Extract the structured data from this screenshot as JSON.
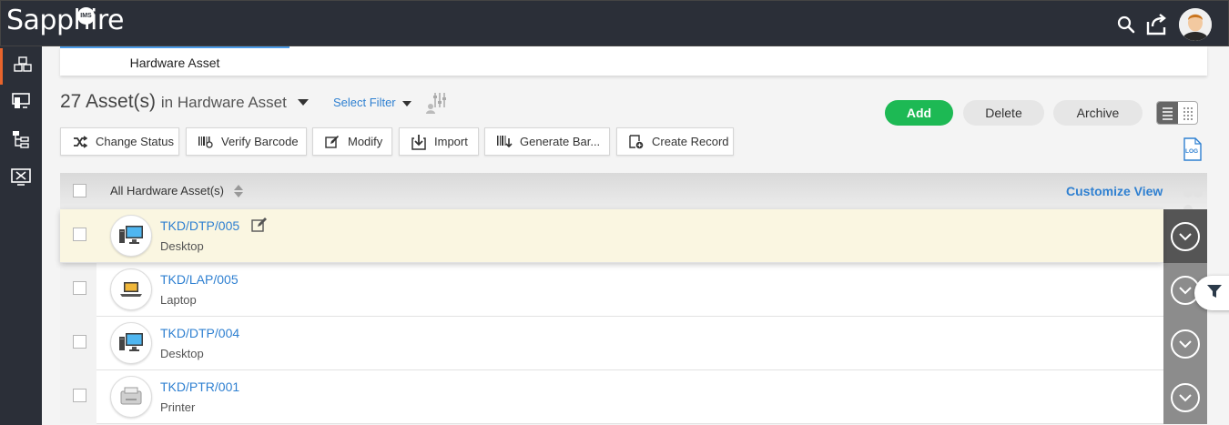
{
  "app": {
    "logo_text": "Sapphire",
    "logo_badge": "IMS"
  },
  "topbar": {
    "icons": [
      "search-icon",
      "logout-icon",
      "user-avatar"
    ]
  },
  "sidebar": {
    "items": [
      {
        "name": "assets-cubes-icon",
        "active": true
      },
      {
        "name": "devices-icon",
        "active": false
      },
      {
        "name": "hierarchy-icon",
        "active": false
      },
      {
        "name": "monitor-tools-icon",
        "active": false
      }
    ]
  },
  "tabs": [
    {
      "label": "Hardware Asset",
      "active": true
    }
  ],
  "header": {
    "count_label": "27 Asset(s)",
    "in_label": "in Hardware Asset",
    "select_filter": "Select Filter"
  },
  "actions": {
    "add": "Add",
    "delete": "Delete",
    "archive": "Archive"
  },
  "toolbar": {
    "change_status": "Change Status",
    "verify_barcode": "Verify Barcode",
    "modify": "Modify",
    "import": "Import",
    "generate_barcode": "Generate Bar...",
    "create_record": "Create Record",
    "log_label": "LOG"
  },
  "table": {
    "header_label": "All Hardware Asset(s)",
    "customize_view": "Customize View",
    "rows": [
      {
        "id": "TKD/DTP/005",
        "type": "Desktop",
        "icon": "desktop-icon",
        "highlight": true
      },
      {
        "id": "TKD/LAP/005",
        "type": "Laptop",
        "icon": "laptop-icon",
        "highlight": false
      },
      {
        "id": "TKD/DTP/004",
        "type": "Desktop",
        "icon": "desktop-icon",
        "highlight": false
      },
      {
        "id": "TKD/PTR/001",
        "type": "Printer",
        "icon": "printer-icon",
        "highlight": false
      }
    ]
  },
  "colors": {
    "accent_blue": "#2f80d1",
    "add_green": "#1db954",
    "topbar_bg": "#2b2f38",
    "active_marker": "#e8642c",
    "highlight_row": "#faf6e1"
  }
}
